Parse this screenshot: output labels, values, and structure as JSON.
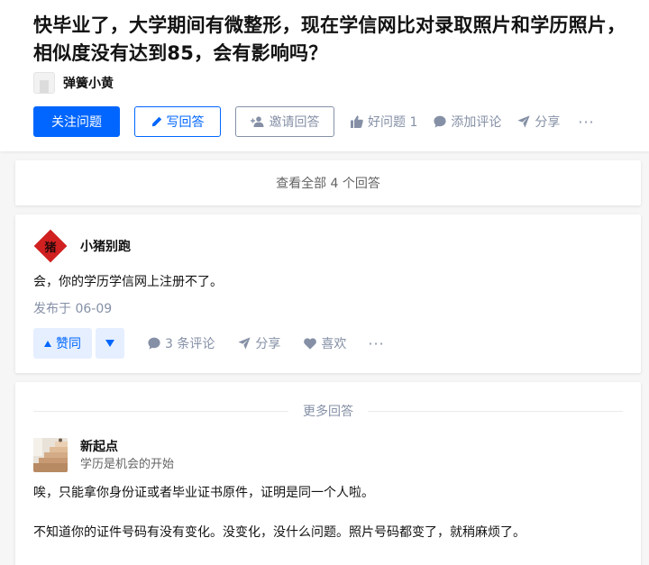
{
  "question": {
    "title": "快毕业了，大学期间有微整形，现在学信网比对录取照片和学历照片，相似度没有达到85，会有影响吗？",
    "asker_name": "弹簧小黄"
  },
  "actions": {
    "follow_label": "关注问题",
    "write_label": "写回答",
    "invite_label": "邀请回答",
    "good_question_label": "好问题 1",
    "add_comment_label": "添加评论",
    "share_label": "分享"
  },
  "view_all_label": "查看全部 4 个回答",
  "answer1": {
    "author_name": "小猪别跑",
    "avatar_char": "猪",
    "text": "会，你的学历学信网上注册不了。",
    "date": "发布于 06-09",
    "upvote_label": "赞同",
    "comments_label": "3 条评论",
    "share_label": "分享",
    "like_label": "喜欢"
  },
  "more_answers": {
    "divider_label": "更多回答",
    "author_name": "新起点",
    "author_bio": "学历是机会的开始",
    "paragraph1": "唉，只能拿你身份证或者毕业证书原件，证明是同一个人啦。",
    "paragraph2": "不知道你的证件号码有没有变化。没变化，没什么问题。照片号码都变了，就稍麻烦了。"
  },
  "colors": {
    "brand_blue": "#0066ff",
    "muted_gray": "#8590a6",
    "vote_bg": "#e5efff",
    "avatar_red": "#d12020"
  },
  "icons": [
    "pencil-icon",
    "invite-user-icon",
    "thumbs-up-icon",
    "comment-icon",
    "share-icon",
    "more-icon",
    "upvote-triangle-icon",
    "downvote-triangle-icon",
    "heart-icon"
  ]
}
